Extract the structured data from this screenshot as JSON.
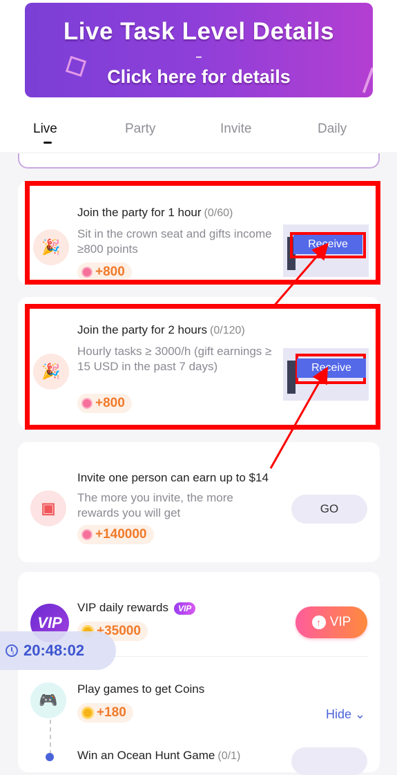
{
  "banner": {
    "title": "Live Task Level Details",
    "dash": "–",
    "subtitle": "Click here for details"
  },
  "tabs": [
    {
      "label": "Live",
      "active": true
    },
    {
      "label": "Party",
      "active": false
    },
    {
      "label": "Invite",
      "active": false
    },
    {
      "label": "Daily",
      "active": false
    }
  ],
  "tasks": [
    {
      "title": "Join the party for 1 hour",
      "count": "(0/60)",
      "desc": "Sit in the crown seat and gifts income ≥800 points",
      "reward": "+800",
      "button": "Receive",
      "icon": "party-popper-icon"
    },
    {
      "title": "Join the party for 2 hours",
      "count": "(0/120)",
      "desc": "Hourly tasks ≥ 3000/h (gift earnings ≥ 15 USD in the past 7 days)",
      "reward": "+800",
      "button": "Receive",
      "icon": "party-popper-icon"
    }
  ],
  "invite": {
    "title": "Invite one person can earn up to $14",
    "desc": "The more you invite, the more rewards you will get",
    "reward": "+140000",
    "button": "GO",
    "icon": "gift-box-icon"
  },
  "vip": {
    "icon_text": "VIP",
    "title": "VIP daily rewards",
    "badge": "VIP",
    "reward": "+35000",
    "button": "VIP"
  },
  "games": {
    "title": "Play games to get Coins",
    "reward": "+180",
    "hide_label": "Hide",
    "icon": "gamepad-icon"
  },
  "ocean": {
    "title": "Win an Ocean Hunt Game",
    "count": "(0/1)"
  },
  "clock": {
    "time": "20:48:02"
  },
  "colors": {
    "accent": "#4b63d8",
    "annotation_red": "#ff0000",
    "banner_purple": "#8f3fd9",
    "reward_orange": "#f07a2a"
  }
}
